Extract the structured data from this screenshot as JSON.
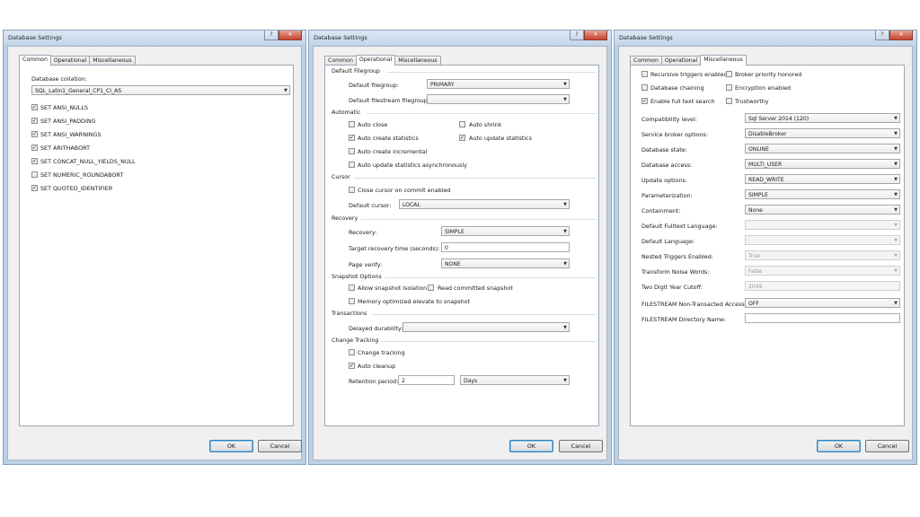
{
  "windows": [
    {
      "title": "Database Settings",
      "tabs": [
        "Common",
        "Operational",
        "Miscellaneous"
      ],
      "collation_label": "Database collation:",
      "collation_value": "SQL_Latin1_General_CP1_CI_AS",
      "options": [
        {
          "label": "SET ANSI_NULLS",
          "checked": true
        },
        {
          "label": "SET ANSI_PADDING",
          "checked": true
        },
        {
          "label": "SET ANSI_WARNINGS",
          "checked": true
        },
        {
          "label": "SET ARITHABORT",
          "checked": true
        },
        {
          "label": "SET CONCAT_NULL_YIELDS_NULL",
          "checked": true
        },
        {
          "label": "SET NUMERIC_ROUNDABORT",
          "checked": false
        },
        {
          "label": "SET QUOTED_IDENTIFIER",
          "checked": true
        }
      ],
      "ok": "OK",
      "cancel": "Cancel"
    },
    {
      "title": "Database Settings",
      "tabs": [
        "Common",
        "Operational",
        "Miscellaneous"
      ],
      "groups": {
        "filegroup": "Default Filegroup",
        "automatic": "Automatic",
        "cursor": "Cursor",
        "recovery": "Recovery",
        "snapshot": "Snapshot Options",
        "transactions": "Transactions",
        "tracking": "Change Tracking"
      },
      "default_filegroup_label": "Default filegroup:",
      "default_filegroup_value": "PRIMARY",
      "filestream_filegroup_label": "Default filestream filegroup:",
      "filestream_filegroup_value": "",
      "auto_close": {
        "label": "Auto close",
        "checked": false
      },
      "auto_shrink": {
        "label": "Auto shrink",
        "checked": false
      },
      "auto_create_stats": {
        "label": "Auto create statistics",
        "checked": true
      },
      "auto_update_stats": {
        "label": "Auto update statistics",
        "checked": true
      },
      "auto_create_incremental": {
        "label": "Auto create incremental",
        "checked": false
      },
      "auto_update_async": {
        "label": "Auto update statistics asynchronously",
        "checked": false
      },
      "close_cursor": {
        "label": "Close cursor on commit enabled",
        "checked": false
      },
      "default_cursor_label": "Default cursor:",
      "default_cursor_value": "LOCAL",
      "recovery_label": "Recovery:",
      "recovery_value": "SIMPLE",
      "target_recovery_label": "Target recovery time (seconds):",
      "target_recovery_value": "0",
      "page_verify_label": "Page verify:",
      "page_verify_value": "NONE",
      "allow_snapshot": {
        "label": "Allow snapshot isolation",
        "checked": false
      },
      "read_committed_snapshot": {
        "label": "Read committed snapshot",
        "checked": false
      },
      "memory_optimized": {
        "label": "Memory optimized elevate to snapshot",
        "checked": false
      },
      "delayed_durability_label": "Delayed durability:",
      "delayed_durability_value": "",
      "change_tracking": {
        "label": "Change tracking",
        "checked": false
      },
      "auto_cleanup": {
        "label": "Auto cleanup",
        "checked": true
      },
      "retention_label": "Retention period:",
      "retention_value": "2",
      "retention_unit": "Days",
      "ok": "OK",
      "cancel": "Cancel"
    },
    {
      "title": "Database Settings",
      "tabs": [
        "Common",
        "Operational",
        "Miscellaneous"
      ],
      "checks": [
        {
          "label": "Recursive triggers enabled",
          "checked": false
        },
        {
          "label": "Broker priority honored",
          "checked": false
        },
        {
          "label": "Database chaining",
          "checked": false
        },
        {
          "label": "Encryption enabled",
          "checked": false
        },
        {
          "label": "Enable full text search",
          "checked": true
        },
        {
          "label": "Trustworthy",
          "checked": false
        }
      ],
      "fields": [
        {
          "label": "Compatibility level:",
          "value": "Sql Server 2014 (120)"
        },
        {
          "label": "Service broker options:",
          "value": "DisableBroker"
        },
        {
          "label": "Database state:",
          "value": "ONLINE"
        },
        {
          "label": "Database access:",
          "value": "MULTI_USER"
        },
        {
          "label": "Update options:",
          "value": "READ_WRITE"
        },
        {
          "label": "Parameterization:",
          "value": "SIMPLE"
        },
        {
          "label": "Containment:",
          "value": "None"
        },
        {
          "label": "Default Fulltext Language:",
          "value": ""
        },
        {
          "label": "Default Language:",
          "value": ""
        },
        {
          "label": "Nested Triggers Enabled:",
          "value": "True"
        },
        {
          "label": "Transform Noise Words:",
          "value": "False"
        },
        {
          "label": "Two Digit Year Cutoff:",
          "value": "2049"
        },
        {
          "label": "FILESTREAM Non-Transacted Access:",
          "value": "OFF"
        },
        {
          "label": "FILESTREAM Directory Name:",
          "value": ""
        }
      ],
      "ok": "OK",
      "cancel": "Cancel"
    }
  ]
}
